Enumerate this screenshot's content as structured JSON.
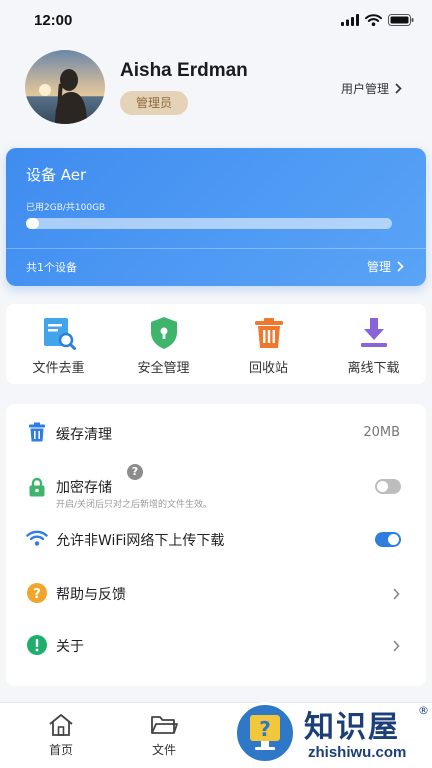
{
  "status_bar": {
    "time": "12:00"
  },
  "profile": {
    "name": "Aisha Erdman",
    "role": "管理员",
    "user_management": "用户管理"
  },
  "device": {
    "title": "设备 Aer",
    "storage_text": "已用2GB/共100GB",
    "used_fraction": 0.02,
    "count_text": "共1个设备",
    "manage_label": "管理"
  },
  "tools": [
    {
      "label": "文件去重",
      "icon": "file-search-icon",
      "color": "#3aa0e8"
    },
    {
      "label": "安全管理",
      "icon": "shield-lock-icon",
      "color": "#3db36b"
    },
    {
      "label": "回收站",
      "icon": "trash-bin-icon",
      "color": "#f0782e"
    },
    {
      "label": "离线下载",
      "icon": "download-tray-icon",
      "color": "#8b63d8"
    }
  ],
  "settings": {
    "cache": {
      "label": "缓存清理",
      "value": "20MB",
      "icon": "trash-icon"
    },
    "encrypt": {
      "label": "加密存储",
      "sub": "开启/关闭后只对之后新增的文件生效。",
      "enabled": false,
      "icon": "lock-icon"
    },
    "wifi": {
      "label": "允许非WiFi网络下上传下载",
      "enabled": true,
      "icon": "wifi-icon"
    },
    "help": {
      "label": "帮助与反馈",
      "icon": "question-circle-icon"
    },
    "about": {
      "label": "关于",
      "icon": "info-circle-icon"
    }
  },
  "nav": {
    "home": "首页",
    "files": "文件"
  },
  "watermark": {
    "text": "知识屋",
    "reg": "®",
    "domain": "zhishiwu.com"
  },
  "colors": {
    "accent": "#3f8cf0",
    "toggle_on": "#2f7de1",
    "toggle_off": "#bdbdbd"
  }
}
